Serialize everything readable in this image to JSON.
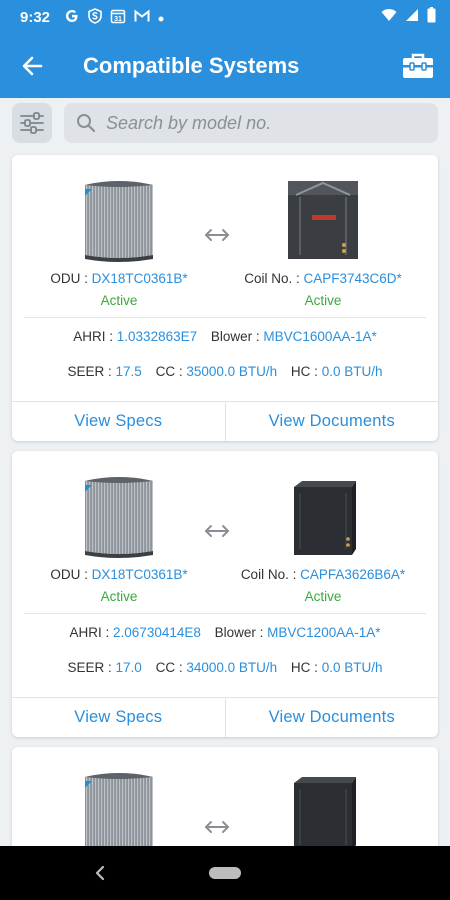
{
  "status_bar": {
    "time": "9:32",
    "left_icons": [
      "google-icon",
      "shield-s-icon",
      "calendar-31-icon",
      "gmail-icon",
      "dot-icon"
    ],
    "calendar_day": "31",
    "right_icons": [
      "wifi-icon",
      "signal-icon",
      "battery-icon"
    ]
  },
  "app_bar": {
    "title": "Compatible Systems",
    "back_icon": "arrow-left-icon",
    "action_icon": "toolbox-icon"
  },
  "search": {
    "placeholder": "Search by model no.",
    "value": ""
  },
  "labels": {
    "odu": "ODU : ",
    "coil": "Coil No. : ",
    "ahri": "AHRI : ",
    "blower": "Blower : ",
    "seer": "SEER : ",
    "cc": "CC : ",
    "hc": "HC : ",
    "view_specs": "View Specs",
    "view_documents": "View Documents"
  },
  "systems": [
    {
      "odu": "DX18TC0361B*",
      "odu_status": "Active",
      "coil": "CAPF3743C6D*",
      "coil_status": "Active",
      "ahri": "1.0332863E7",
      "blower": "MBVC1600AA-1A*",
      "seer": "17.5",
      "cc": "35000.0 BTU/h",
      "hc": "0.0 BTU/h"
    },
    {
      "odu": "DX18TC0361B*",
      "odu_status": "Active",
      "coil": "CAPFA3626B6A*",
      "coil_status": "Active",
      "ahri": "2.06730414E8",
      "blower": "MBVC1200AA-1A*",
      "seer": "17.0",
      "cc": "34000.0 BTU/h",
      "hc": "0.0 BTU/h"
    }
  ],
  "colors": {
    "primary": "#2a8fdc",
    "active_green": "#3aa83a",
    "background": "#eef1f4"
  }
}
